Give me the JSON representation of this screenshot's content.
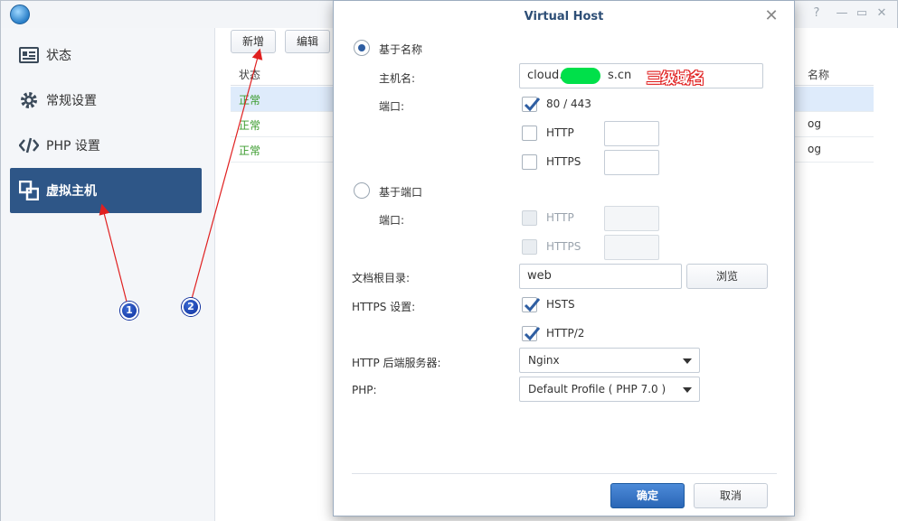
{
  "sidebar": {
    "items": [
      {
        "label": "状态",
        "icon": "status-card-icon"
      },
      {
        "label": "常规设置",
        "icon": "gear-icon"
      },
      {
        "label": "PHP 设置",
        "icon": "code-icon"
      },
      {
        "label": "虚拟主机",
        "icon": "virtual-host-icon",
        "active": true
      }
    ]
  },
  "toolbar": {
    "add_label": "新增",
    "edit_label": "编辑"
  },
  "grid": {
    "col_status": "状态",
    "col_name": "名称",
    "rows": [
      {
        "status": "正常",
        "name": ""
      },
      {
        "status": "正常",
        "name": "og"
      },
      {
        "status": "正常",
        "name": "og"
      }
    ]
  },
  "dialog": {
    "title": "Virtual Host",
    "name_based": {
      "label": "基于名称",
      "hostname_label": "主机名:",
      "hostname_value": "cloud.l",
      "hostname_suffix": "s.cn",
      "port_label": "端口:",
      "port_80_443": "80 / 443",
      "http_label": "HTTP",
      "https_label": "HTTPS"
    },
    "port_based": {
      "label": "基于端口",
      "port_label": "端口:",
      "http_label": "HTTP",
      "https_label": "HTTPS"
    },
    "docroot_label": "文档根目录:",
    "docroot_value": "web",
    "browse_label": "浏览",
    "https_settings_label": "HTTPS 设置:",
    "hsts_label": "HSTS",
    "http2_label": "HTTP/2",
    "backend_label": "HTTP 后端服务器:",
    "backend_value": "Nginx",
    "php_label": "PHP:",
    "php_value": "Default Profile ( PHP 7.0 )",
    "ok_label": "确定",
    "cancel_label": "取消"
  },
  "annotations": {
    "domain_note": "三级域名",
    "badge_1": "1",
    "badge_2": "2",
    "arrow_color": "#e02020"
  },
  "colors": {
    "sidebar_active": "#2e5687",
    "status_ok": "#3a9b2c",
    "primary_button": "#2a66b6",
    "mask_green": "#00e04a"
  }
}
